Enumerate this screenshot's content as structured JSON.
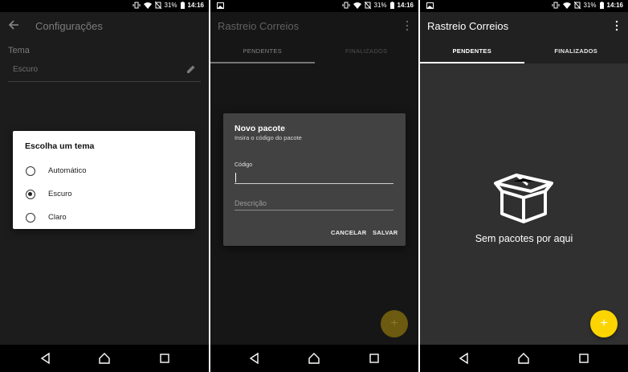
{
  "statusbar": {
    "battery": "31%",
    "time": "14:16"
  },
  "screen1": {
    "title": "Configurações",
    "setting_label": "Tema",
    "setting_value": "Escuro",
    "dialog": {
      "title": "Escolha um tema",
      "options": [
        {
          "label": "Automático",
          "checked": false
        },
        {
          "label": "Escuro",
          "checked": true
        },
        {
          "label": "Claro",
          "checked": false
        }
      ]
    }
  },
  "screen2": {
    "title": "Rastreio Correios",
    "tabs": [
      "PENDENTES",
      "FINALIZADOS"
    ],
    "dialog": {
      "title": "Novo pacote",
      "subtitle": "Insira o código do pacote",
      "code_label": "Código",
      "code_value": "",
      "description_placeholder": "Descrição",
      "cancel": "CANCELAR",
      "save": "SALVAR"
    },
    "fab_icon": "+"
  },
  "screen3": {
    "title": "Rastreio Correios",
    "tabs": [
      "PENDENTES",
      "FINALIZADOS"
    ],
    "empty_text": "Sem pacotes por aqui",
    "fab_icon": "+"
  },
  "colors": {
    "accent": "#fcd500",
    "dark_bg": "#1c1c1c",
    "surface": "#303030",
    "dialog_dark": "#424242"
  }
}
